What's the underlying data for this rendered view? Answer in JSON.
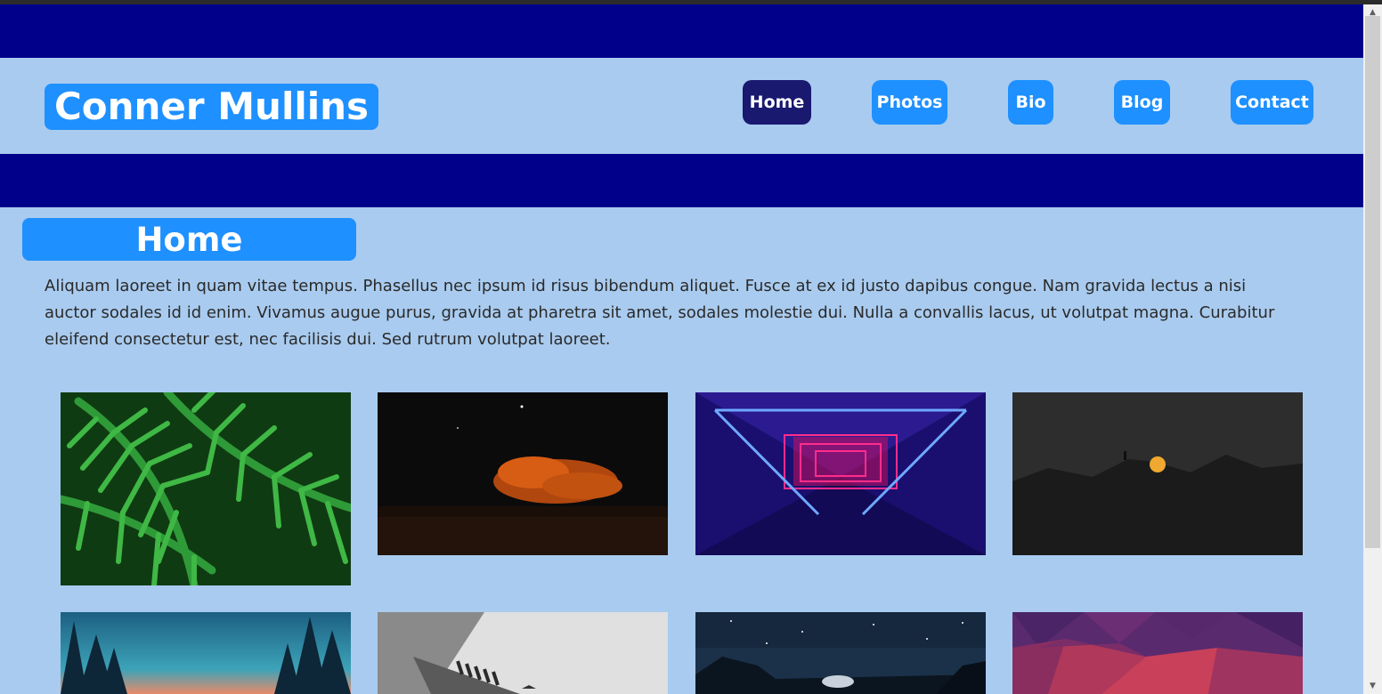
{
  "site": {
    "title": "Conner Mullins"
  },
  "nav": {
    "items": [
      {
        "label": "Home",
        "active": true
      },
      {
        "label": "Photos",
        "active": false
      },
      {
        "label": "Bio",
        "active": false
      },
      {
        "label": "Blog",
        "active": false
      },
      {
        "label": "Contact",
        "active": false
      }
    ]
  },
  "main": {
    "heading": "Home",
    "intro": "Aliquam laoreet in quam vitae tempus. Phasellus nec ipsum id risus bibendum aliquet. Fusce at ex id justo dapibus congue. Nam gravida lectus a nisi auctor sodales id id enim. Vivamus augue purus, gravida at pharetra sit amet, sodales molestie dui. Nulla a convallis lacus, ut volutpat magna. Curabitur eleifend consectetur est, nec facilisis dui. Sed rutrum volutpat laoreet."
  },
  "gallery": {
    "photos": [
      {
        "subject": "green fern leaves with water droplets"
      },
      {
        "subject": "orange cloud at night over dark landscape"
      },
      {
        "subject": "neon pink and blue corridor"
      },
      {
        "subject": "dark silhouette landscape with orange moon"
      },
      {
        "subject": "teal sky with pine tree silhouettes"
      },
      {
        "subject": "grey architectural structure"
      },
      {
        "subject": "starry night sky over hills"
      },
      {
        "subject": "purple and red low-poly pattern"
      }
    ]
  },
  "colors": {
    "band": "#00008b",
    "background": "#a9cbef",
    "button": "#1e90ff",
    "button_active": "#191970",
    "text": "#2a2a2a"
  }
}
